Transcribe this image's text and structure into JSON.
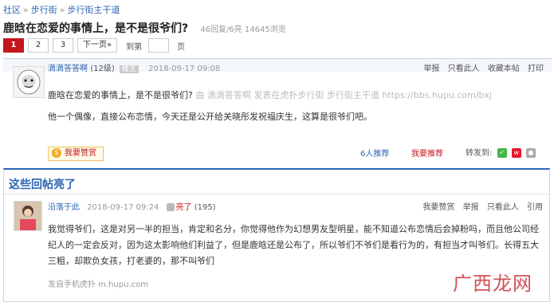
{
  "breadcrumb": {
    "items": [
      "社区",
      "步行街",
      "步行街主干道"
    ],
    "separator": "»"
  },
  "thread": {
    "title": "鹿晗在恋爱的事情上，是不是很爷们?",
    "stats": "46回复/6亮  14645浏览"
  },
  "pager": {
    "pages": [
      "1",
      "2",
      "3"
    ],
    "current": "1",
    "next": "下一页»",
    "goto_label": "到第",
    "page_unit": "页"
  },
  "main_post": {
    "author": "滴滴答答啊",
    "level": "(12级)",
    "role_badge": "楼主",
    "datetime": "2018-09-17 09:08",
    "actions": [
      "举报",
      "只看此人",
      "收藏本帖",
      "打印"
    ],
    "quote_title": "鹿晗在恋爱的事情上，是不是很爷们?",
    "quote_source": "由  滴滴答答啊 发表在虎扑步行街 步行街主干道 https://bbs.hupu.com/bxj",
    "body": "他一个偶像，直接公布恋情，今天还是公开给关晓彤发祝福庆生，这算是很爷们吧。",
    "zan_label": "我要赞赏",
    "recommend_count": "6人推荐",
    "recommend_action": "我要推荐",
    "share_label": "转发到:",
    "share_icons": [
      "wechat-icon",
      "weibo-icon",
      "qq-icon"
    ]
  },
  "hot_section": {
    "title": "这些回帖亮了",
    "reply": {
      "author": "沿落于此",
      "datetime": "2018-09-17 09:24",
      "light_label": "亮了",
      "light_count": "(195)",
      "actions": [
        "我要赞赏",
        "举报",
        "只看此人",
        "引用"
      ],
      "body_lines": [
        "我觉得爷们，这是对另一半的担当，肯定和名分，你觉得他作为幻想男友型明星，能不知道公布恋情后会掉粉吗，而且他公司经",
        "纪人的一定会反对，因为这太影响他们利益了，但是鹿晗还是公布了，所以爷们不爷们是看行为的，有担当才叫爷们。长得五大",
        "三粗，却欺负女孩，打老婆的，那不叫爷们"
      ],
      "via": "发自手机虎扑 m.hupu.com"
    }
  },
  "watermark": "广西龙网",
  "colors": {
    "brand_red": "#c3161d",
    "link_blue": "#2d64b3",
    "border_blue": "#c9d6e6"
  }
}
